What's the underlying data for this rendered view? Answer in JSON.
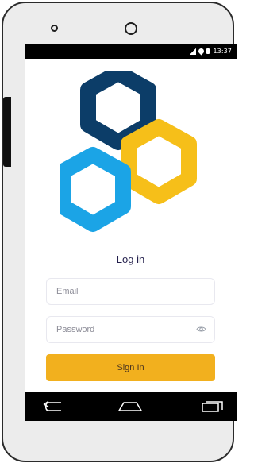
{
  "status_bar": {
    "time": "13:37",
    "icons": [
      "signal-icon",
      "wifi-icon",
      "battery-icon"
    ]
  },
  "brand": {
    "logo_colors": [
      "#0c3d68",
      "#f6bf19",
      "#1ba4e6"
    ]
  },
  "login": {
    "title": "Log in",
    "email_placeholder": "Email",
    "password_placeholder": "Password",
    "signin_label": "Sign In",
    "accent_color": "#f2b01e"
  },
  "navigation": {
    "icons": [
      "back-icon",
      "home-icon",
      "recent-apps-icon"
    ]
  }
}
